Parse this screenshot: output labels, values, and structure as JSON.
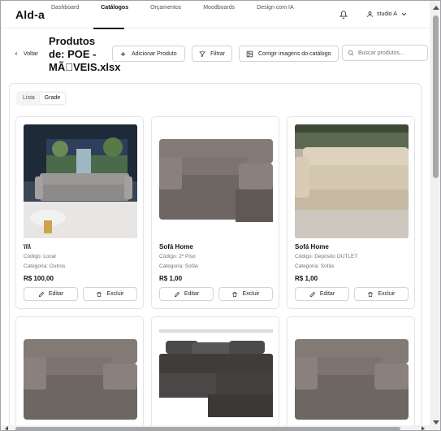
{
  "app": {
    "logo": "Ald-a"
  },
  "nav": {
    "links": [
      "Dashboard",
      "Catálogos",
      "Orçamentos",
      "Moodboards",
      "Design com IA"
    ],
    "active_index": 1,
    "user_label": "studio A"
  },
  "header": {
    "back_label": "Voltar",
    "title": "Produtos de: POE - MÃ\u0000VEIS.xlsx",
    "add_label": "Adicionar Produto",
    "filter_label": "Filtrar",
    "fix_images_label": "Corrigir imagens do catálogo",
    "search_placeholder": "Buscar produtos..."
  },
  "view_toggle": {
    "list_label": "Lista",
    "grid_label": "Grade",
    "active": "Grade"
  },
  "products": [
    {
      "name": "\\\\\\\\",
      "code": "Código: Local",
      "category": "Categoria: Outros",
      "price": "R$ 100,00",
      "image": "living-room-sofa"
    },
    {
      "name": "Sofá Home",
      "code": "Código: 2º Piso",
      "category": "Categoria: Sofás",
      "price": "R$ 1,00",
      "image": "grey-sofa"
    },
    {
      "name": "Sofá Home",
      "code": "Código: Depósito OUTLET",
      "category": "Categoria: Sofás",
      "price": "R$ 1,00",
      "image": "beige-sofa"
    },
    {
      "name": "",
      "code": "",
      "category": "",
      "price": "",
      "image": "grey-sofa"
    },
    {
      "name": "",
      "code": "",
      "category": "",
      "price": "",
      "image": "dark-modular-sofa"
    },
    {
      "name": "",
      "code": "",
      "category": "",
      "price": "",
      "image": "grey-sofa"
    }
  ],
  "card_actions": {
    "edit_label": "Editar",
    "delete_label": "Excluir"
  },
  "colors": {
    "accent": "#18181b",
    "border": "#e4e4e7",
    "muted_text": "#71717a"
  }
}
